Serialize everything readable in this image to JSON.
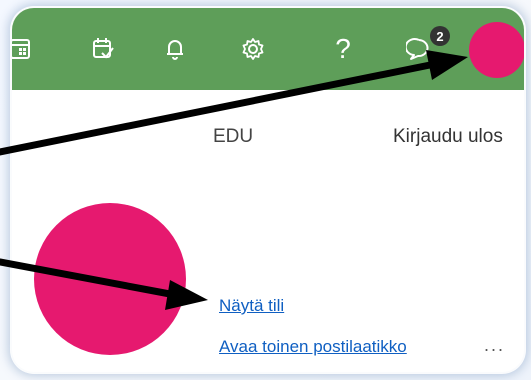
{
  "header": {
    "color": "#5e9e59",
    "icons": [
      "calendar-icon",
      "tasks-icon",
      "bell-icon",
      "gear-icon",
      "help-icon",
      "chat-icon"
    ],
    "help_glyph": "?",
    "chat_badge_count": "2"
  },
  "account": {
    "org_name": "EDU",
    "sign_out_label": "Kirjaudu ulos",
    "avatar_color": "#e6196f",
    "view_account_label": "Näytä tili",
    "open_mailbox_label": "Avaa toinen postilaatikko",
    "more_label": "..."
  },
  "annotations": {
    "arrow_color": "#000000"
  }
}
